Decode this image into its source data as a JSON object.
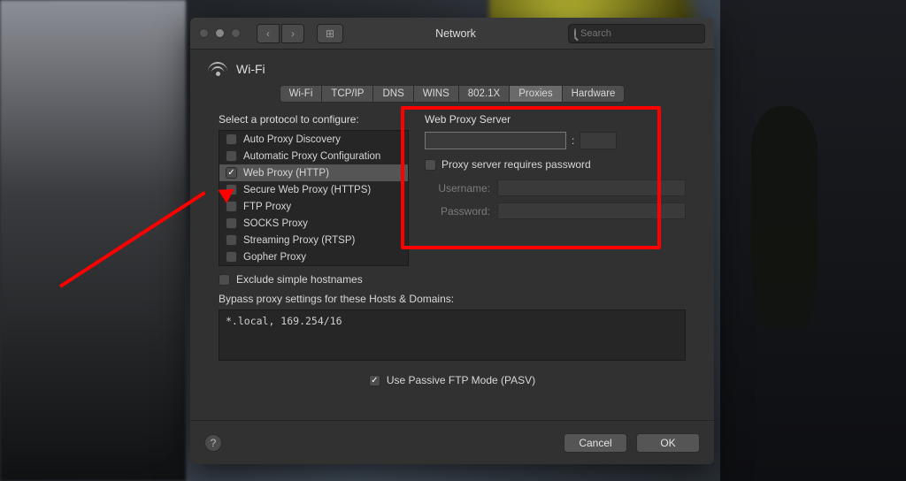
{
  "toolbar": {
    "title": "Network",
    "search_placeholder": "Search"
  },
  "header": {
    "service": "Wi-Fi"
  },
  "tabs": [
    "Wi-Fi",
    "TCP/IP",
    "DNS",
    "WINS",
    "802.1X",
    "Proxies",
    "Hardware"
  ],
  "active_tab": "Proxies",
  "left": {
    "label": "Select a protocol to configure:",
    "protocols": [
      {
        "label": "Auto Proxy Discovery",
        "checked": false,
        "selected": false
      },
      {
        "label": "Automatic Proxy Configuration",
        "checked": false,
        "selected": false
      },
      {
        "label": "Web Proxy (HTTP)",
        "checked": true,
        "selected": true
      },
      {
        "label": "Secure Web Proxy (HTTPS)",
        "checked": false,
        "selected": false
      },
      {
        "label": "FTP Proxy",
        "checked": false,
        "selected": false
      },
      {
        "label": "SOCKS Proxy",
        "checked": false,
        "selected": false
      },
      {
        "label": "Streaming Proxy (RTSP)",
        "checked": false,
        "selected": false
      },
      {
        "label": "Gopher Proxy",
        "checked": false,
        "selected": false
      }
    ]
  },
  "right": {
    "title": "Web Proxy Server",
    "host": "",
    "port": "",
    "sep": ":",
    "reqpass_label": "Proxy server requires password",
    "reqpass_checked": false,
    "username_label": "Username:",
    "password_label": "Password:"
  },
  "exclude": {
    "checked": false,
    "label": "Exclude simple hostnames"
  },
  "bypass": {
    "label": "Bypass proxy settings for these Hosts & Domains:",
    "value": "*.local, 169.254/16"
  },
  "pasv": {
    "checked": true,
    "label": "Use Passive FTP Mode (PASV)"
  },
  "footer": {
    "cancel": "Cancel",
    "ok": "OK"
  }
}
